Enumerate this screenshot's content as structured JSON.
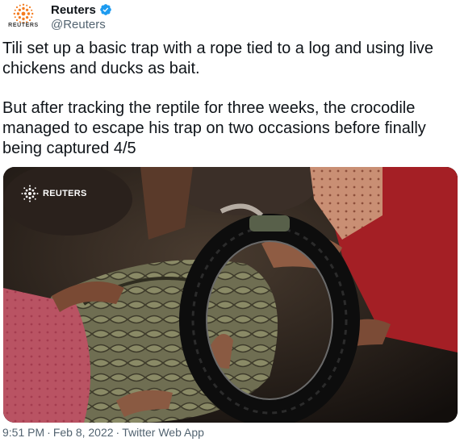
{
  "account": {
    "logo_wordmark": "REUTERS",
    "display_name": "Reuters",
    "handle": "@Reuters",
    "verified_icon": "verified-badge-icon",
    "verified_color": "#1d9bf0"
  },
  "tweet": {
    "paragraphs": [
      "Tili set up a basic trap with a rope tied to a log and using live chickens and ducks as bait.",
      "But after tracking the reptile for three weeks, the crocodile managed to escape his trap on two occasions before finally being captured 4/5"
    ],
    "media": {
      "watermark": "REUTERS",
      "watermark_icon": "reuters-logo-icon"
    }
  },
  "footer": {
    "time": "9:51 PM",
    "date": "Feb 8, 2022",
    "source": "Twitter Web App",
    "separator": "·"
  },
  "colors": {
    "text": "#0f1419",
    "secondary": "#536471",
    "logo_orange": "#f47c20"
  }
}
